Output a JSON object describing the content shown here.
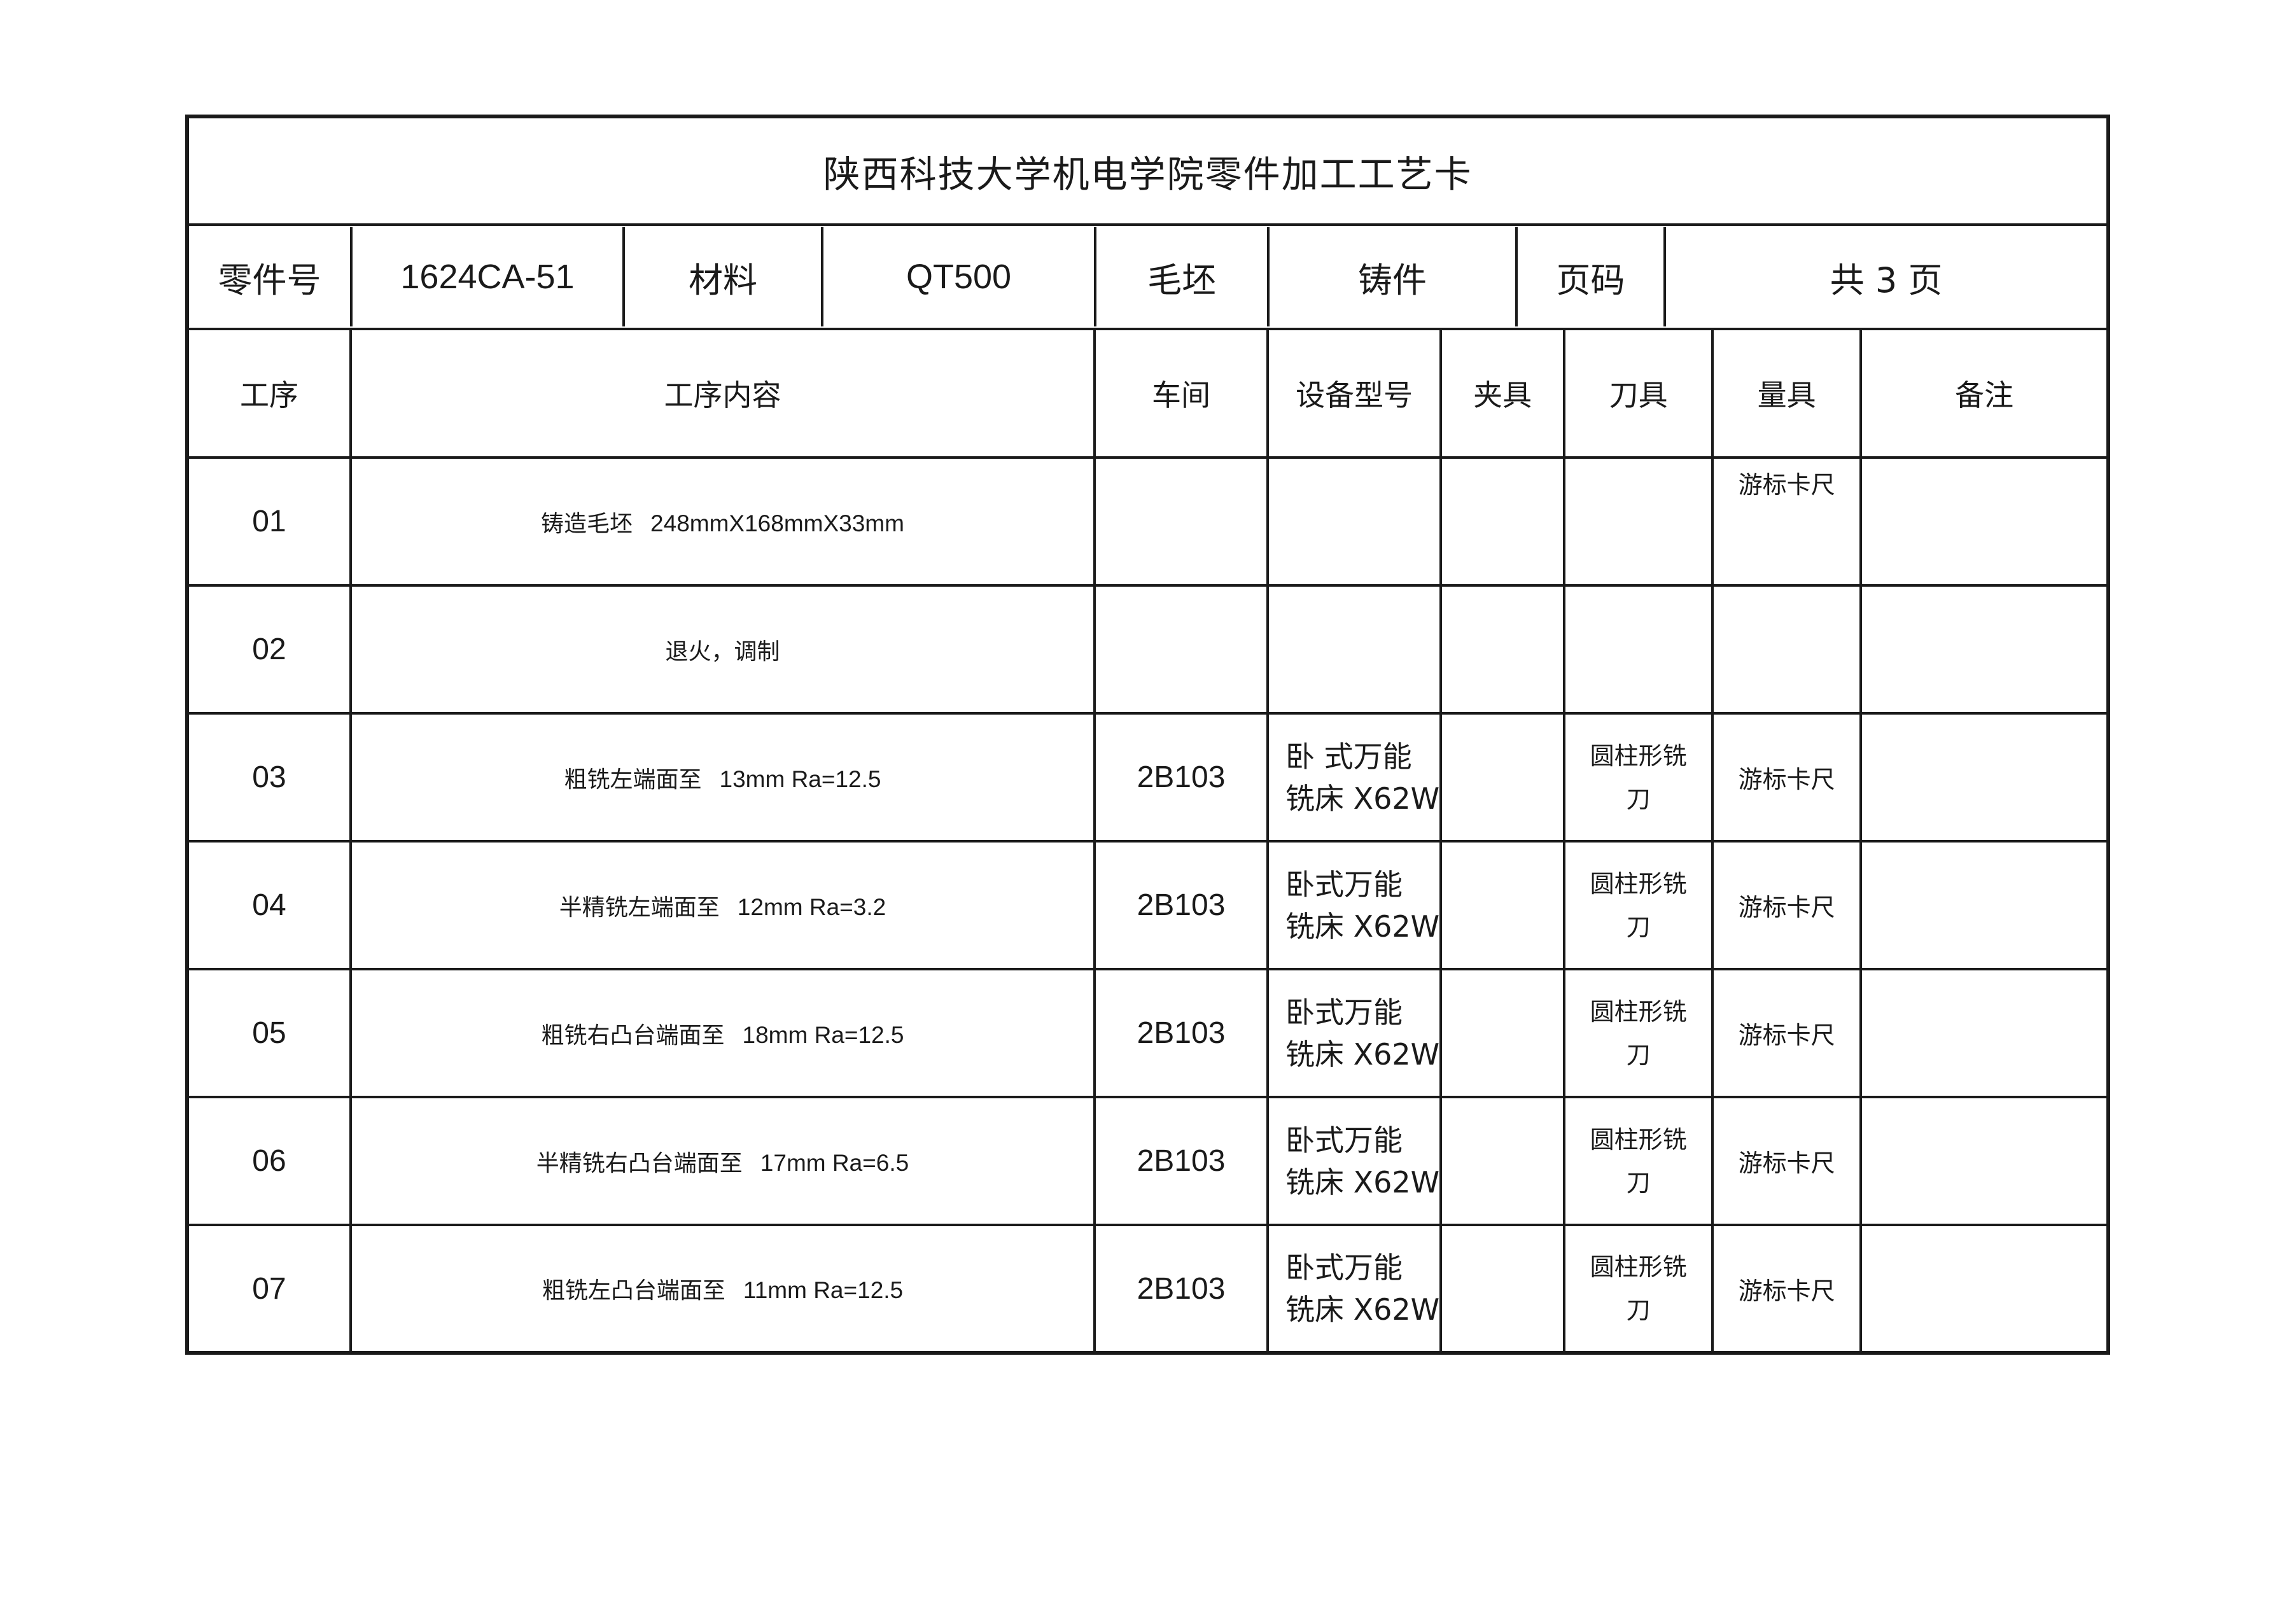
{
  "title": "陕西科技大学机电学院零件加工工艺卡",
  "info": {
    "part_no_label": "零件号",
    "part_no": "1624CA-51",
    "material_label": "材料",
    "material": "QT500",
    "blank_label": "毛坯",
    "blank": "铸件",
    "page_label": "页码",
    "page": "共 3 页"
  },
  "headers": {
    "op": "工序",
    "content": "工序内容",
    "workshop": "车间",
    "equipment": "设备型号",
    "fixture": "夹具",
    "tool": "刀具",
    "gauge": "量具",
    "note": "备注"
  },
  "operations": [
    {
      "no": "01",
      "content_text": "铸造毛坯",
      "content_value": "248mmX168mmX33mm",
      "workshop": "",
      "equipment_line1": "",
      "equipment_line2": "",
      "fixture": "",
      "tool_line1": "",
      "tool_line2": "",
      "gauge": "游标卡尺",
      "note": ""
    },
    {
      "no": "02",
      "content_text": "退火，调制",
      "content_value": "",
      "workshop": "",
      "equipment_line1": "",
      "equipment_line2": "",
      "fixture": "",
      "tool_line1": "",
      "tool_line2": "",
      "gauge": "",
      "note": ""
    },
    {
      "no": "03",
      "content_text": "粗铣左端面至",
      "content_value": "13mm  Ra=12.5",
      "workshop": "2B103",
      "equipment_line1": "卧 式万能",
      "equipment_line2": "铣床  X62W",
      "fixture": "",
      "tool_line1": "圆柱形铣",
      "tool_line2": "刀",
      "gauge": "游标卡尺",
      "note": ""
    },
    {
      "no": "04",
      "content_text": "半精铣左端面至",
      "content_value": "12mm  Ra=3.2",
      "workshop": "2B103",
      "equipment_line1": "卧式万能",
      "equipment_line2": "铣床  X62W",
      "fixture": "",
      "tool_line1": "圆柱形铣",
      "tool_line2": "刀",
      "gauge": "游标卡尺",
      "note": ""
    },
    {
      "no": "05",
      "content_text": "粗铣右凸台端面至",
      "content_value": "18mm  Ra=12.5",
      "workshop": "2B103",
      "equipment_line1": "卧式万能",
      "equipment_line2": "铣床  X62W",
      "fixture": "",
      "tool_line1": "圆柱形铣",
      "tool_line2": "刀",
      "gauge": "游标卡尺",
      "note": ""
    },
    {
      "no": "06",
      "content_text": "半精铣右凸台端面至",
      "content_value": "17mm  Ra=6.5",
      "workshop": "2B103",
      "equipment_line1": "卧式万能",
      "equipment_line2": "铣床  X62W",
      "fixture": "",
      "tool_line1": "圆柱形铣",
      "tool_line2": "刀",
      "gauge": "游标卡尺",
      "note": ""
    },
    {
      "no": "07",
      "content_text": "粗铣左凸台端面至",
      "content_value": "11mm  Ra=12.5",
      "workshop": "2B103",
      "equipment_line1": "卧式万能",
      "equipment_line2": "铣床  X62W",
      "fixture": "",
      "tool_line1": "圆柱形铣",
      "tool_line2": "刀",
      "gauge": "游标卡尺",
      "note": ""
    }
  ]
}
